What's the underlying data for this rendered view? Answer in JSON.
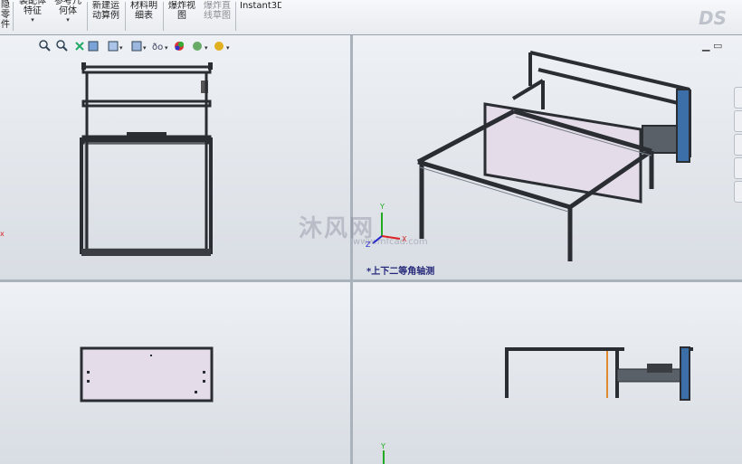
{
  "toolbar": {
    "items": [
      {
        "label": "隐\n零\n件",
        "dropdown": false
      },
      {
        "label": "装配体\n特征",
        "dropdown": true
      },
      {
        "label": "参考几\n何体",
        "dropdown": true
      },
      {
        "label": "新建运\n动算例",
        "dropdown": false
      },
      {
        "label": "材料明\n细表",
        "dropdown": false
      },
      {
        "label": "爆炸视\n图",
        "dropdown": false
      },
      {
        "label": "爆炸直\n线草图",
        "dropdown": false
      },
      {
        "label": "Instant3D",
        "dropdown": false
      }
    ]
  },
  "heads_up": {
    "icons": [
      "zoom-to-fit-icon",
      "zoom-to-area-icon",
      "previous-view-icon",
      "section-view-icon",
      "view-orientation-icon",
      "display-style-icon",
      "hide-show-items-icon",
      "edit-appearance-icon",
      "apply-scene-icon",
      "view-settings-icon"
    ]
  },
  "viewport": {
    "isometric_label": "*上下二等角轴测",
    "watermark_text": "沐风网",
    "watermark_url": "www.mfcad.com"
  },
  "window_controls": {
    "restore": "▁",
    "tile": "▭"
  },
  "colors": {
    "frame": "#2a2e33",
    "frame_light": "#6a727b",
    "panel": "#e4dce8",
    "axis_x": "#d22",
    "axis_y": "#2a2",
    "axis_z": "#22c",
    "label": "#26287a"
  }
}
